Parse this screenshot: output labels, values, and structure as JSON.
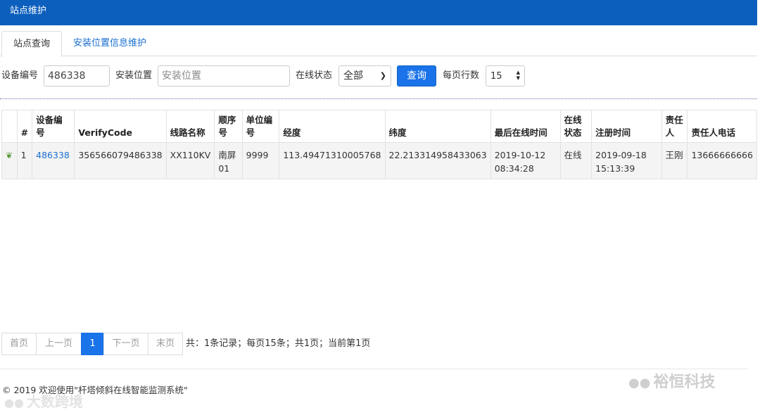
{
  "header": {
    "title": "站点维护"
  },
  "tabs": [
    {
      "label": "站点查询"
    },
    {
      "label": "安装位置信息维护"
    }
  ],
  "filters": {
    "device_label": "设备编号",
    "device_value": "486338",
    "location_label": "安装位置",
    "location_placeholder": "安装位置",
    "status_label": "在线状态",
    "status_selected": "全部",
    "query_label": "查询",
    "rows_label": "每页行数",
    "rows_value": "15"
  },
  "table": {
    "columns": [
      "#",
      "设备编号",
      "VerifyCode",
      "线路名称",
      "顺序号",
      "单位编号",
      "经度",
      "纬度",
      "最后在线时间",
      "在线状态",
      "注册时间",
      "责任人",
      "责任人电话"
    ],
    "rows": [
      {
        "index": "1",
        "device_id": "486338",
        "verify_code": "356566079486338",
        "line_name": "XX110KV",
        "sequence": "南屏01",
        "unit_no": "9999",
        "longitude": "113.49471310005768",
        "latitude": "22.213314958433063",
        "last_online": "2019-10-12 08:34:28",
        "status": "在线",
        "registered": "2019-09-18 15:13:39",
        "owner": "王刚",
        "owner_phone": "13666666666"
      }
    ]
  },
  "pagination": {
    "first": "首页",
    "prev": "上一页",
    "current": "1",
    "next": "下一页",
    "last": "末页",
    "info": "共：1条记录；每页15条；共1页；当前第1页"
  },
  "footer": {
    "text": "© 2019 欢迎使用\"杆塔倾斜在线智能监测系统\""
  },
  "watermarks": {
    "brand": "裕恒科技",
    "left": "大数跨境",
    "icon": "wechat-icon"
  },
  "icons": {
    "row_icon": "leaf-icon"
  },
  "colors": {
    "header": "#0d5fbd",
    "primary": "#1a73e8",
    "link": "#1a6fd0"
  }
}
